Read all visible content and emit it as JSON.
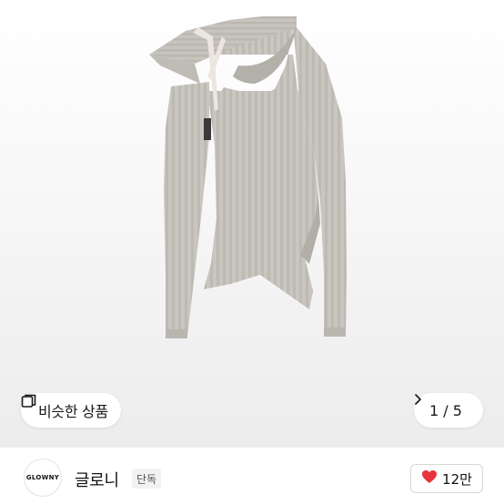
{
  "product": {
    "image_icon": "ribbed-knit-sweater-photo",
    "image_index": 1,
    "image_total": 5,
    "counter_label": "1 / 5",
    "counter_icon": "chevron-right-icon"
  },
  "similar": {
    "icon": "similar-items-icon",
    "label": "비슷한 상품"
  },
  "brand": {
    "logo_text": "GLOWNY",
    "name": "글로니",
    "badge": "단독"
  },
  "like": {
    "icon": "heart-icon",
    "count": "12만",
    "color": "#e8333c"
  }
}
